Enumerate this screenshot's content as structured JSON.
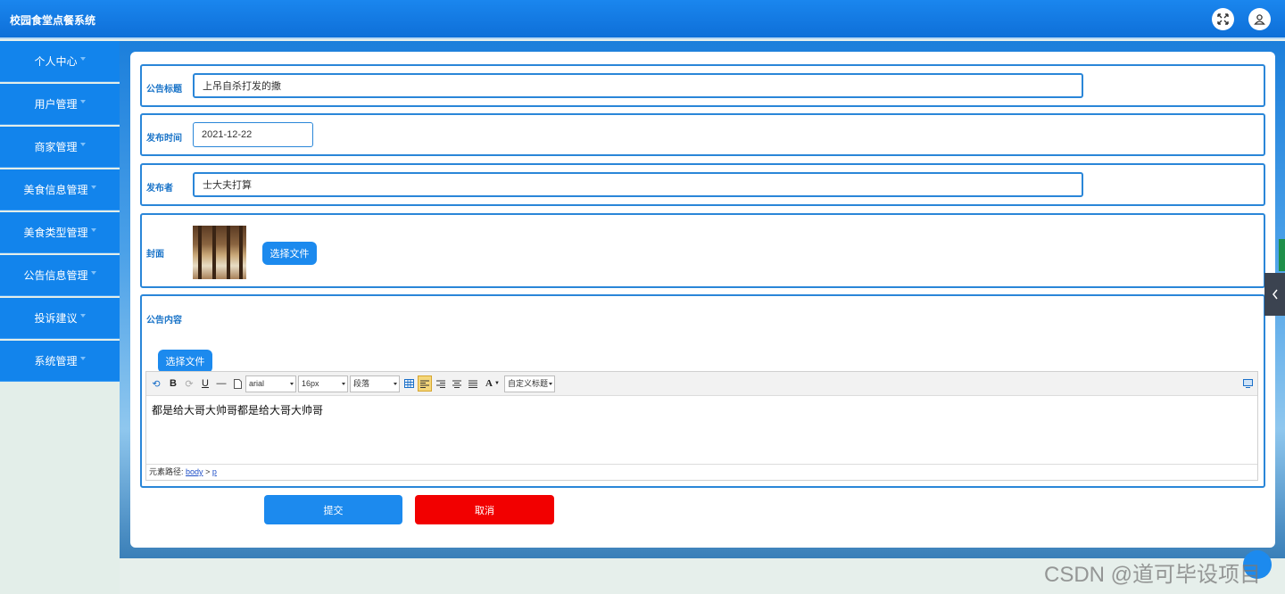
{
  "app": {
    "title": "校园食堂点餐系统"
  },
  "header": {
    "fullscreen_icon": "expand-icon",
    "user_icon": "user-icon"
  },
  "sidebar": {
    "items": [
      {
        "label": "个人中心"
      },
      {
        "label": "用户管理"
      },
      {
        "label": "商家管理"
      },
      {
        "label": "美食信息管理"
      },
      {
        "label": "美食类型管理"
      },
      {
        "label": "公告信息管理"
      },
      {
        "label": "投诉建议"
      },
      {
        "label": "系统管理"
      }
    ]
  },
  "form": {
    "title_label": "公告标题",
    "title_value": "上吊自杀打发的撒",
    "date_label": "发布时间",
    "date_value": "2021-12-22",
    "publisher_label": "发布者",
    "publisher_value": "士大夫打算",
    "cover_label": "封面",
    "cover_button": "选择文件",
    "content_label": "公告内容",
    "content_button": "选择文件",
    "submit_label": "提交",
    "cancel_label": "取消"
  },
  "editor": {
    "font_family": "arial",
    "font_size": "16px",
    "paragraph": "段落",
    "custom_heading": "自定义标题",
    "content": "都是给大哥大帅哥都是给大哥大帅哥",
    "path_prefix": "元素路径:",
    "path_body": "body",
    "path_sep": ">",
    "path_p": "p"
  },
  "colors": {
    "primary": "#1c8aee",
    "danger": "#f20000",
    "border": "#2a86d8"
  },
  "watermark": "CSDN @道可毕设项目"
}
